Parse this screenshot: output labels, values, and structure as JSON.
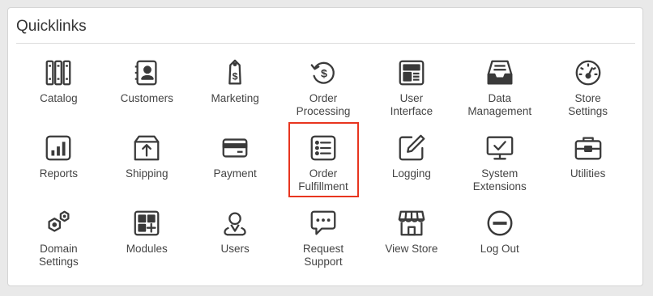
{
  "panel": {
    "title": "Quicklinks"
  },
  "colors": {
    "icon": "#3a3a3a",
    "highlight": "#e8351f",
    "text": "#444444"
  },
  "tiles": [
    {
      "label": "Catalog",
      "icon": "catalog-binders-icon"
    },
    {
      "label": "Customers",
      "icon": "address-book-icon"
    },
    {
      "label": "Marketing",
      "icon": "price-tag-icon"
    },
    {
      "label": "Order\nProcessing",
      "icon": "dollar-cycle-icon"
    },
    {
      "label": "User\nInterface",
      "icon": "layout-icon"
    },
    {
      "label": "Data\nManagement",
      "icon": "inbox-tray-icon"
    },
    {
      "label": "Store\nSettings",
      "icon": "gauge-icon"
    },
    {
      "label": "Reports",
      "icon": "bar-chart-icon"
    },
    {
      "label": "Shipping",
      "icon": "package-icon"
    },
    {
      "label": "Payment",
      "icon": "credit-card-icon"
    },
    {
      "label": "Order\nFulfillment",
      "icon": "checklist-icon",
      "highlighted": true
    },
    {
      "label": "Logging",
      "icon": "edit-icon"
    },
    {
      "label": "System\nExtensions",
      "icon": "monitor-check-icon"
    },
    {
      "label": "Utilities",
      "icon": "toolbox-icon"
    },
    {
      "label": "Domain\nSettings",
      "icon": "hex-nut-icon"
    },
    {
      "label": "Modules",
      "icon": "modules-grid-icon"
    },
    {
      "label": "Users",
      "icon": "user-pin-icon"
    },
    {
      "label": "Request\nSupport",
      "icon": "chat-bubble-icon"
    },
    {
      "label": "View Store",
      "icon": "storefront-icon"
    },
    {
      "label": "Log Out",
      "icon": "minus-circle-icon"
    }
  ]
}
